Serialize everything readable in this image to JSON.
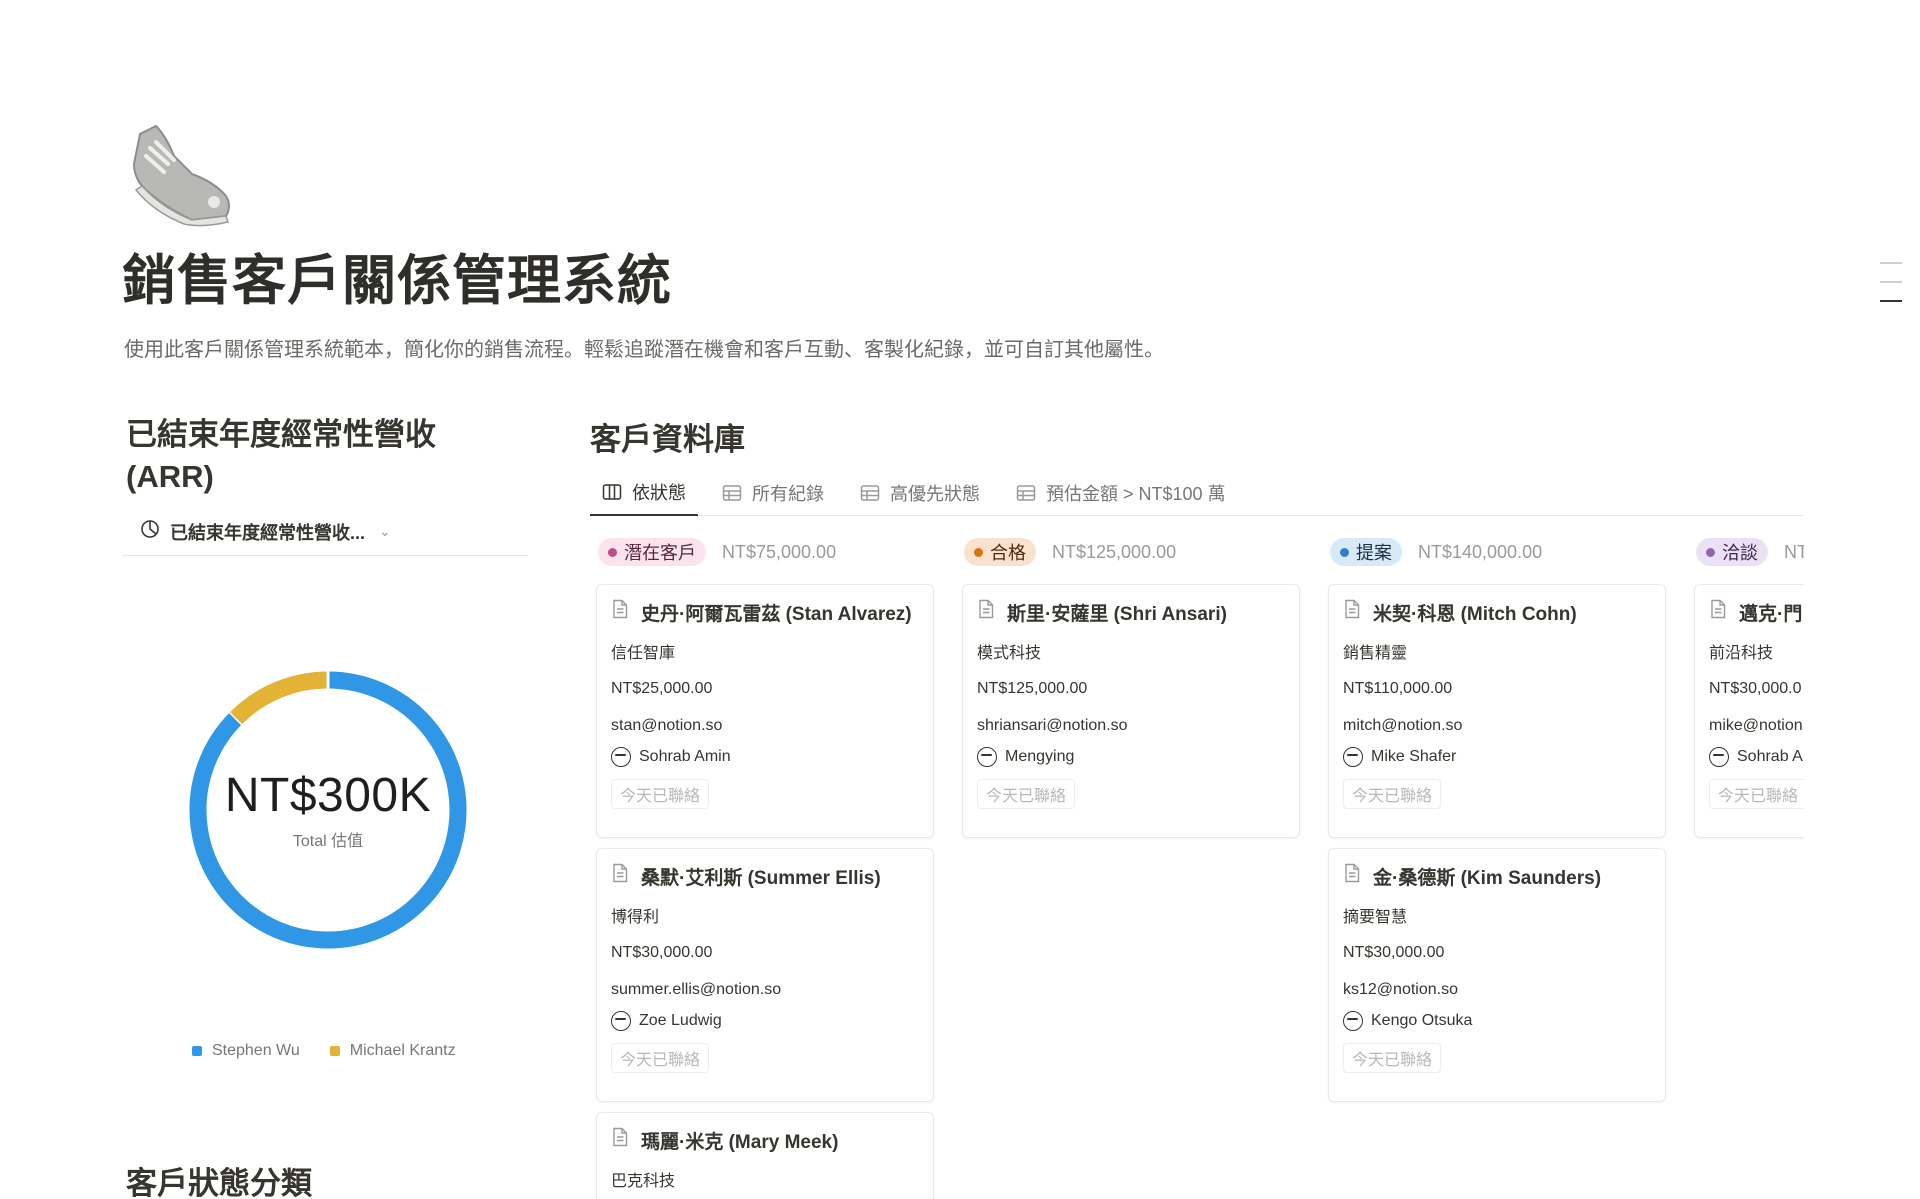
{
  "page": {
    "title": "銷售客戶關係管理系統",
    "description": "使用此客戶關係管理系統範本，簡化你的銷售流程。輕鬆追蹤潛在機會和客戶互動、客製化紀錄，並可自訂其他屬性。",
    "icon": "sneaker-icon"
  },
  "arr": {
    "heading": "已結束年度經常性營收 (ARR)",
    "view_label": "已結束年度經常性營收...",
    "chart_data": {
      "type": "pie",
      "variant": "donut",
      "center_value": "NT$300K",
      "center_label": "Total 估值",
      "slices": [
        {
          "name": "Stephen Wu",
          "fraction": 0.875,
          "color": "#2f97e6"
        },
        {
          "name": "Michael Krantz",
          "fraction": 0.125,
          "color": "#e3b336"
        }
      ],
      "legend_position": "bottom"
    }
  },
  "status_heading": "客戶狀態分類",
  "database": {
    "heading": "客戶資料庫",
    "tabs": [
      {
        "label": "依狀態",
        "icon": "board-icon",
        "active": true
      },
      {
        "label": "所有紀錄",
        "icon": "table-icon",
        "active": false
      },
      {
        "label": "高優先狀態",
        "icon": "table-icon",
        "active": false
      },
      {
        "label": "預估金額 > NT$100 萬",
        "icon": "table-icon",
        "active": false
      }
    ],
    "columns": [
      {
        "status": "潛在客戶",
        "total": "NT$75,000.00",
        "badge_bg": "#fbe4ee",
        "badge_fg": "#5a2741",
        "dot": "#c14c8a",
        "cards": [
          {
            "name": "史丹·阿爾瓦雷茲 (Stan Alvarez)",
            "company": "信任智庫",
            "amount": "NT$25,000.00",
            "email": "stan@notion.so",
            "owner": "Sohrab Amin",
            "contact": "今天已聯絡"
          },
          {
            "name": "桑默·艾利斯 (Summer Ellis)",
            "company": "博得利",
            "amount": "NT$30,000.00",
            "email": "summer.ellis@notion.so",
            "owner": "Zoe Ludwig",
            "contact": "今天已聯絡"
          },
          {
            "name": "瑪麗·米克 (Mary Meek)",
            "company": "巴克科技",
            "amount": "",
            "email": "",
            "owner": "",
            "contact": ""
          }
        ]
      },
      {
        "status": "合格",
        "total": "NT$125,000.00",
        "badge_bg": "#fbe2cf",
        "badge_fg": "#4d2a12",
        "dot": "#d9730d",
        "cards": [
          {
            "name": "斯里·安薩里 (Shri Ansari)",
            "company": "模式科技",
            "amount": "NT$125,000.00",
            "email": "shriansari@notion.so",
            "owner": "Mengying",
            "contact": "今天已聯絡"
          }
        ]
      },
      {
        "status": "提案",
        "total": "NT$140,000.00",
        "badge_bg": "#d8eaf7",
        "badge_fg": "#183347",
        "dot": "#2f80c8",
        "cards": [
          {
            "name": "米契·科恩 (Mitch Cohn)",
            "company": "銷售精靈",
            "amount": "NT$110,000.00",
            "email": "mitch@notion.so",
            "owner": "Mike Shafer",
            "contact": "今天已聯絡"
          },
          {
            "name": "金·桑德斯 (Kim Saunders)",
            "company": "摘要智慧",
            "amount": "NT$30,000.00",
            "email": "ks12@notion.so",
            "owner": "Kengo Otsuka",
            "contact": "今天已聯絡"
          }
        ]
      },
      {
        "status": "洽談",
        "total": "NT",
        "badge_bg": "#ebe1f5",
        "badge_fg": "#412454",
        "dot": "#9065b0",
        "cards": [
          {
            "name": "邁克·門",
            "company": "前沿科技",
            "amount": "NT$30,000.0",
            "email": "mike@notion.",
            "owner": "Sohrab A",
            "contact": "今天已聯絡"
          }
        ]
      }
    ]
  }
}
